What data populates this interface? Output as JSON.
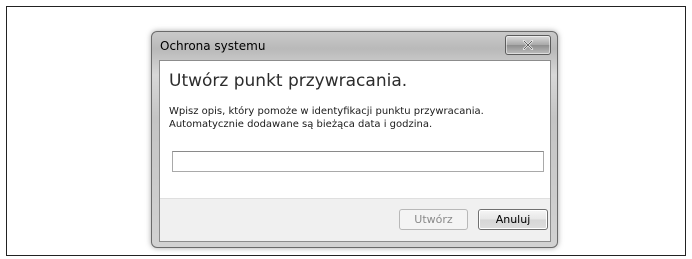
{
  "window": {
    "title": "Ochrona systemu"
  },
  "dialog": {
    "heading": "Utwórz punkt przywracania.",
    "description": "Wpisz opis, który pomoże w identyfikacji punktu przywracania. Automatycznie dodawane są bieżąca data i godzina.",
    "input_value": "",
    "create_label": "Utwórz",
    "cancel_label": "Anuluj"
  },
  "icons": {
    "close": "close-icon"
  }
}
